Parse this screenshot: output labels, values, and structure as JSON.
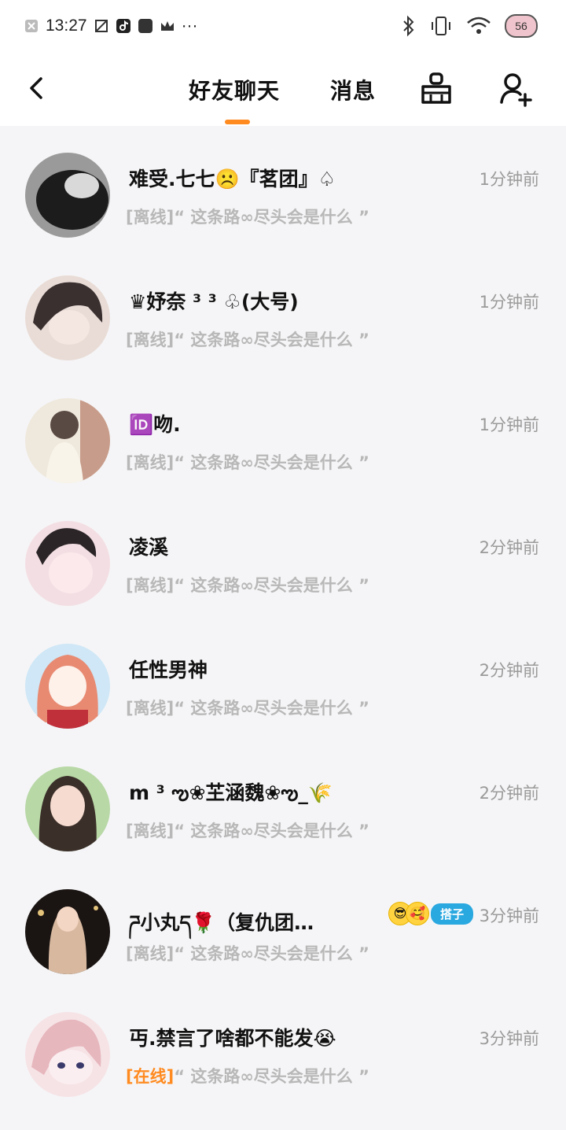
{
  "status_bar": {
    "time": "13:27",
    "more": "···",
    "battery": "56",
    "icons": [
      "notification-x-icon",
      "app-icon",
      "tiktok-icon",
      "square-icon",
      "crown-icon",
      "bluetooth-icon",
      "vibrate-icon",
      "wifi-icon"
    ]
  },
  "header": {
    "tab_friends": "好友聊天",
    "tab_messages": "消息",
    "accent_color": "#ff8a1f",
    "icons": [
      "back-arrow-icon",
      "broom-icon",
      "add-user-icon"
    ]
  },
  "chats": [
    {
      "name": "难受.七七☹️『茗团』♤",
      "time": "1分钟前",
      "status": "[离线]",
      "preview": "“ 这条路∞尽头会是什么 ”",
      "avatar_colors": [
        "#1c1c1c",
        "#9a9a9a"
      ]
    },
    {
      "name": "♛妤奈 ³ ³ ♧(大号)",
      "time": "1分钟前",
      "status": "[离线]",
      "preview": "“ 这条路∞尽头会是什么 ”",
      "avatar_colors": [
        "#3a3030",
        "#e9dcd6"
      ]
    },
    {
      "name": "🆔吻.",
      "time": "1分钟前",
      "status": "[离线]",
      "preview": "“ 这条路∞尽头会是什么 ”",
      "avatar_colors": [
        "#5a4a44",
        "#efe8dc"
      ]
    },
    {
      "name": "凌溪",
      "time": "2分钟前",
      "status": "[离线]",
      "preview": "“ 这条路∞尽头会是什么 ”",
      "avatar_colors": [
        "#2b2528",
        "#f3dfe3"
      ]
    },
    {
      "name": "任性男神",
      "time": "2分钟前",
      "status": "[离线]",
      "preview": "“ 这条路∞尽头会是什么 ”",
      "avatar_colors": [
        "#e88a72",
        "#cfe7f6"
      ]
    },
    {
      "name": "m ³ ఌ❀芏涵魏❀ఌ_🌾",
      "time": "2分钟前",
      "status": "[离线]",
      "preview": "“ 这条路∞尽头会是什么 ”",
      "avatar_colors": [
        "#3b2f2a",
        "#b8d8a6"
      ]
    },
    {
      "name": "ཌ小丸ད🌹（复仇团…",
      "time": "3分钟前",
      "status": "[离线]",
      "preview": "“ 这条路∞尽头会是什么 ”",
      "avatar_colors": [
        "#1a1412",
        "#d8b9a0"
      ],
      "badge_emojis": [
        "😎",
        "🥰"
      ],
      "badge_tag": "搭子"
    },
    {
      "name": "丏.禁言了啥都不能发😭",
      "time": "3分钟前",
      "status": "[在线]",
      "preview": "“ 这条路∞尽头会是什么 ”",
      "avatar_colors": [
        "#e6b7bd",
        "#f6e3e6"
      ],
      "online": true
    }
  ]
}
